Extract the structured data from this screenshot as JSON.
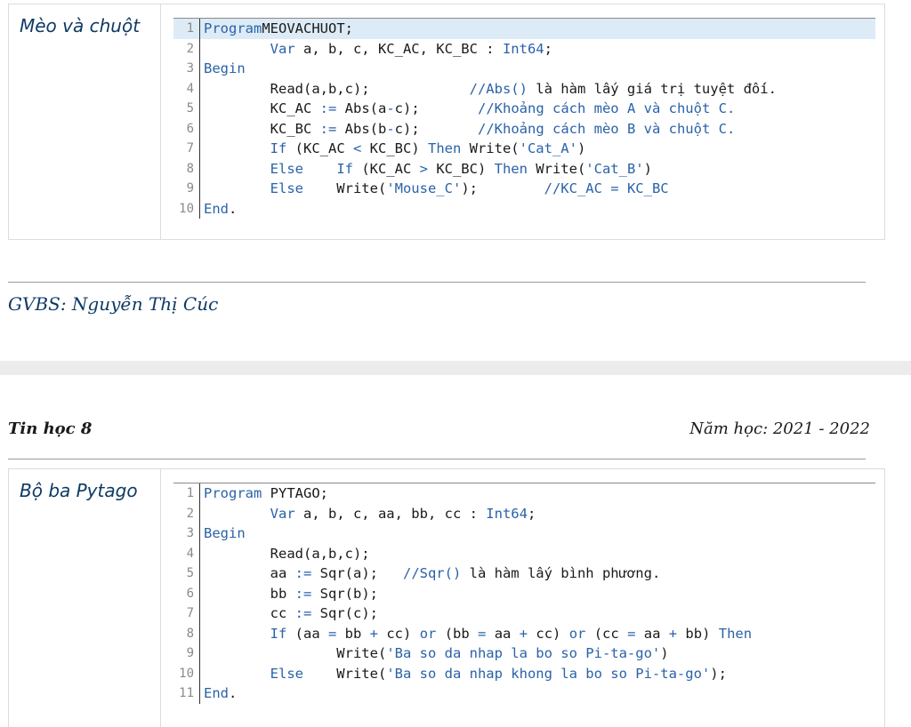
{
  "page1": {
    "section_label": "Mèo và chuột",
    "lines": [
      {
        "n": "1",
        "tokens": [
          [
            "kw",
            "Program"
          ],
          [
            "",
            "MEOVACHUOT;"
          ]
        ]
      },
      {
        "n": "2",
        "tokens": [
          [
            "",
            "        "
          ],
          [
            "kw",
            "Var"
          ],
          [
            "",
            ""
          ],
          [
            "",
            "a, b, c, KC_AC, KC_BC : "
          ],
          [
            "ty",
            "Int64"
          ],
          [
            "",
            ";"
          ]
        ]
      },
      {
        "n": "3",
        "tokens": [
          [
            "kw",
            "Begin"
          ]
        ]
      },
      {
        "n": "4",
        "tokens": [
          [
            "",
            "        Read(a,b,c);            "
          ],
          [
            "cm",
            "//Abs()"
          ],
          [
            "",
            " là hàm lấy giá trị tuyệt đối."
          ]
        ]
      },
      {
        "n": "5",
        "tokens": [
          [
            "",
            "        KC_AC "
          ],
          [
            "op",
            ":="
          ],
          [
            "",
            " Abs(a"
          ],
          [
            "op",
            "-"
          ],
          [
            "",
            "c);       "
          ],
          [
            "cm",
            "//Khoảng cách mèo A và chuột C."
          ]
        ]
      },
      {
        "n": "6",
        "tokens": [
          [
            "",
            "        KC_BC "
          ],
          [
            "op",
            ":="
          ],
          [
            "",
            " Abs(b"
          ],
          [
            "op",
            "-"
          ],
          [
            "",
            "c);       "
          ],
          [
            "cm",
            "//Khoảng cách mèo B và chuột C."
          ]
        ]
      },
      {
        "n": "7",
        "tokens": [
          [
            "kw",
            "        If"
          ],
          [
            "",
            " (KC_AC "
          ],
          [
            "op",
            "<"
          ],
          [
            "",
            " KC_BC) "
          ],
          [
            "kw",
            "Then"
          ],
          [
            "",
            " Write("
          ],
          [
            "st",
            "'Cat_A'"
          ],
          [
            "",
            ")"
          ]
        ]
      },
      {
        "n": "8",
        "tokens": [
          [
            "kw",
            "        Else"
          ],
          [
            "",
            "    "
          ],
          [
            "kw",
            "If"
          ],
          [
            "",
            " (KC_AC "
          ],
          [
            "op",
            ">"
          ],
          [
            "",
            " KC_BC) "
          ],
          [
            "kw",
            "Then"
          ],
          [
            "",
            " Write("
          ],
          [
            "st",
            "'Cat_B'"
          ],
          [
            "",
            ")"
          ]
        ]
      },
      {
        "n": "9",
        "tokens": [
          [
            "kw",
            "        Else"
          ],
          [
            "",
            "    Write("
          ],
          [
            "st",
            "'Mouse_C'"
          ],
          [
            "",
            "); "
          ],
          [
            "",
            "       "
          ],
          [
            "cm",
            "//KC_AC = KC_BC"
          ]
        ]
      },
      {
        "n": "10",
        "tokens": [
          [
            "kw",
            "End"
          ],
          [
            "",
            "."
          ]
        ]
      }
    ]
  },
  "author": "GVBS: Nguyễn Thị Cúc",
  "header": {
    "subject": "Tin học 8",
    "school_year": "Năm học: 2021 - 2022"
  },
  "page2": {
    "section_label": "Bộ ba Pytago",
    "lines": [
      {
        "n": "1",
        "tokens": [
          [
            "kw",
            "Program"
          ],
          [
            "",
            " PYTAGO;"
          ]
        ]
      },
      {
        "n": "2",
        "tokens": [
          [
            "",
            "        "
          ],
          [
            "kw",
            "Var"
          ],
          [
            "",
            " a, b, c, aa, bb, cc : "
          ],
          [
            "ty",
            "Int64"
          ],
          [
            "",
            ";"
          ]
        ]
      },
      {
        "n": "3",
        "tokens": [
          [
            "kw",
            "Begin"
          ]
        ]
      },
      {
        "n": "4",
        "tokens": [
          [
            "",
            "        Read(a,b,c);"
          ]
        ]
      },
      {
        "n": "5",
        "tokens": [
          [
            "",
            "        aa "
          ],
          [
            "op",
            ":="
          ],
          [
            "",
            " Sqr(a);   "
          ],
          [
            "cm",
            "//Sqr()"
          ],
          [
            "",
            " là hàm lấy bình phương."
          ]
        ]
      },
      {
        "n": "6",
        "tokens": [
          [
            "",
            "        bb "
          ],
          [
            "op",
            ":="
          ],
          [
            "",
            " Sqr(b);"
          ]
        ]
      },
      {
        "n": "7",
        "tokens": [
          [
            "",
            "        cc "
          ],
          [
            "op",
            ":="
          ],
          [
            "",
            " Sqr(c);"
          ]
        ]
      },
      {
        "n": "8",
        "tokens": [
          [
            "kw",
            "        If"
          ],
          [
            "",
            " (aa "
          ],
          [
            "op",
            "="
          ],
          [
            "",
            " bb "
          ],
          [
            "op",
            "+"
          ],
          [
            "",
            " cc) "
          ],
          [
            "kw",
            "or"
          ],
          [
            "",
            " (bb "
          ],
          [
            "op",
            "="
          ],
          [
            "",
            " aa "
          ],
          [
            "op",
            "+"
          ],
          [
            "",
            " cc) "
          ],
          [
            "kw",
            "or"
          ],
          [
            "",
            " (cc "
          ],
          [
            "op",
            "="
          ],
          [
            "",
            " aa "
          ],
          [
            "op",
            "+"
          ],
          [
            "",
            " bb) "
          ],
          [
            "kw",
            "Then"
          ]
        ]
      },
      {
        "n": "9",
        "tokens": [
          [
            "",
            "                Write("
          ],
          [
            "st",
            "'Ba so da nhap la bo so Pi-ta-go'"
          ],
          [
            "",
            ")"
          ]
        ]
      },
      {
        "n": "10",
        "tokens": [
          [
            "kw",
            "        Else"
          ],
          [
            "",
            "    Write("
          ],
          [
            "st",
            "'Ba so da nhap khong la bo so Pi-ta-go'"
          ],
          [
            "",
            ");"
          ]
        ]
      },
      {
        "n": "11",
        "tokens": [
          [
            "kw",
            "End"
          ],
          [
            "",
            "."
          ]
        ]
      }
    ]
  }
}
